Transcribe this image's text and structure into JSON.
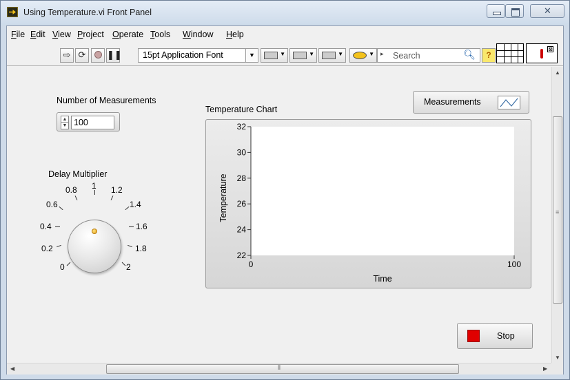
{
  "window": {
    "title": "Using Temperature.vi Front Panel",
    "accent": "#cfdbe9"
  },
  "menu": {
    "items": [
      {
        "key": "F",
        "rest": "ile"
      },
      {
        "key": "E",
        "rest": "dit"
      },
      {
        "key": "V",
        "rest": "iew"
      },
      {
        "key": "P",
        "rest": "roject"
      },
      {
        "key": "O",
        "rest": "perate"
      },
      {
        "key": "T",
        "rest": "ools"
      },
      {
        "key": "W",
        "rest": "indow"
      },
      {
        "key": "H",
        "rest": "elp"
      }
    ]
  },
  "toolbar": {
    "run_icon": "run-arrow-icon",
    "run_continuously_icon": "run-continuously-icon",
    "abort_icon": "abort-icon",
    "pause_icon": "pause-icon",
    "font": "15pt Application Font",
    "align_icon": "align-objects-icon",
    "distribute_icon": "distribute-objects-icon",
    "resize_icon": "resize-objects-icon",
    "reorder_icon": "reorder-icon",
    "search_placeholder": "Search",
    "help_label": "?"
  },
  "panel": {
    "num_measurements_label": "Number of Measurements",
    "num_measurements_value": "100",
    "delay_label": "Delay Multiplier",
    "knob_scale": [
      "0",
      "0.2",
      "0.4",
      "0.6",
      "0.8",
      "1",
      "1.2",
      "1.4",
      "1.6",
      "1.8",
      "2"
    ],
    "knob_value": 1,
    "chart_title": "Temperature Chart",
    "legend_label": "Measurements",
    "stop_label": "Stop",
    "stop_color": "#e00000"
  },
  "chart_data": {
    "type": "line",
    "title": "Temperature Chart",
    "xlabel": "Time",
    "ylabel": "Temperature",
    "xlim": [
      0,
      100
    ],
    "ylim": [
      22,
      32
    ],
    "x_ticks": [
      "0",
      "100"
    ],
    "y_ticks": [
      "22",
      "24",
      "26",
      "28",
      "30",
      "32"
    ],
    "series": [
      {
        "name": "Measurements",
        "values": []
      }
    ],
    "grid": false,
    "legend": "top-right"
  }
}
